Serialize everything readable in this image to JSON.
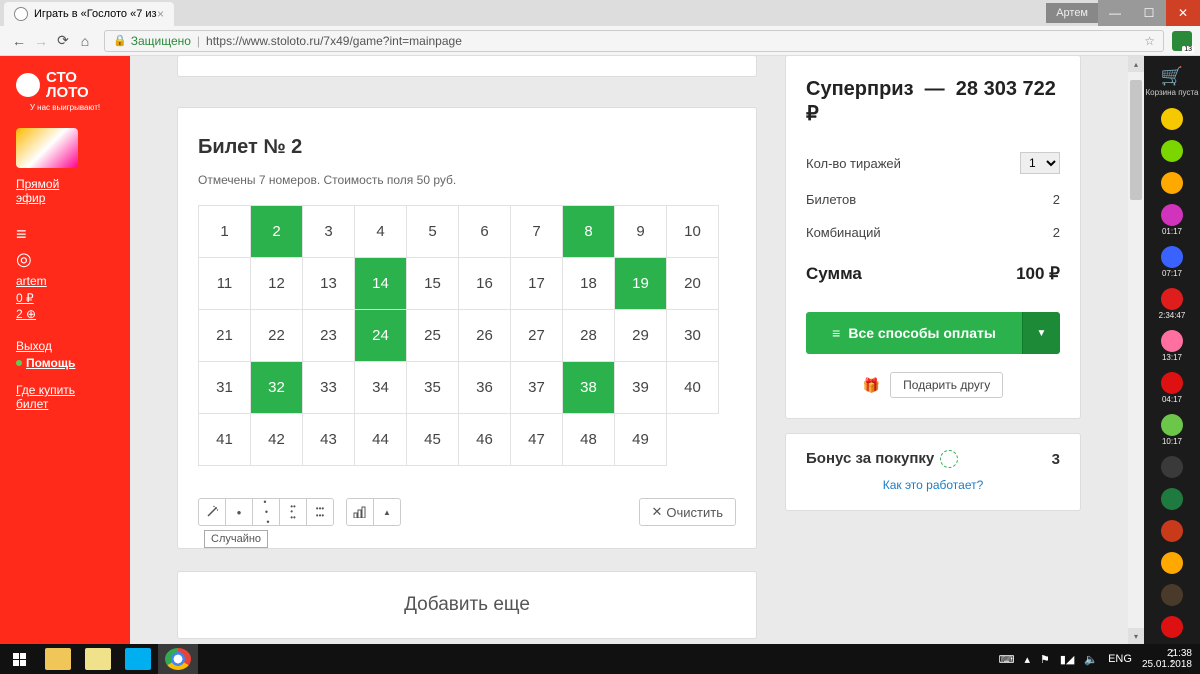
{
  "browser": {
    "tab_title": "Играть в «Гослото «7 из",
    "user": "Артем",
    "secure_label": "Защищено",
    "url": "https://www.stoloto.ru/7x49/game?int=mainpage",
    "ext_badge": "13"
  },
  "sidebar": {
    "logo_line1": "СТО",
    "logo_line2": "ЛОТО",
    "logo_sub": "У нас выигрывают!",
    "live_label_1": "Прямой",
    "live_label_2": "эфир",
    "user": "artem",
    "balance": "0 ₽",
    "tickets": "2 ⊕",
    "logout": "Выход",
    "help": "Помощь",
    "where_1": "Где купить",
    "where_2": "билет"
  },
  "ticket": {
    "title": "Билет № 2",
    "subtitle": "Отмечены 7 номеров. Стоимость поля 50 руб.",
    "max": 49,
    "selected": [
      2,
      8,
      14,
      19,
      24,
      32,
      38
    ],
    "random_tooltip": "Случайно",
    "clear_label": "Очистить"
  },
  "add_more": "Добавить еще",
  "panel": {
    "superprize_label": "Суперприз",
    "superprize_value": "28 303 722 ₽",
    "draws_label": "Кол-во тиражей",
    "draws_value": "1",
    "tickets_label": "Билетов",
    "tickets_value": "2",
    "combos_label": "Комбинаций",
    "combos_value": "2",
    "total_label": "Сумма",
    "total_value": "100 ₽",
    "pay_label": "Все способы оплаты",
    "gift_label": "Подарить другу",
    "bonus_label": "Бонус за покупку",
    "bonus_value": "3",
    "how_label": "Как это работает?"
  },
  "rail": {
    "cart_label": "Корзина пуста",
    "items": [
      {
        "color": "#f5c800",
        "time": ""
      },
      {
        "color": "#7bd600",
        "time": ""
      },
      {
        "color": "#ffa800",
        "time": ""
      },
      {
        "color": "#d233bc",
        "time": "01:17"
      },
      {
        "color": "#3a62ff",
        "time": "07:17"
      },
      {
        "color": "#e01d1d",
        "time": "2:34:47"
      },
      {
        "color": "#ff6fa0",
        "time": "13:17"
      },
      {
        "color": "#d11",
        "time": "04:17"
      },
      {
        "color": "#6cc64a",
        "time": "10:17"
      },
      {
        "color": "#3a3a3a",
        "time": ""
      },
      {
        "color": "#1f7a3f",
        "time": ""
      },
      {
        "color": "#c83a1a",
        "time": ""
      },
      {
        "color": "#ffa800",
        "time": ""
      },
      {
        "color": "#4a3a2a",
        "time": ""
      },
      {
        "color": "#d11",
        "time": ""
      }
    ]
  },
  "taskbar": {
    "lang": "ENG",
    "time": "21:38",
    "date": "25.01.2018"
  }
}
